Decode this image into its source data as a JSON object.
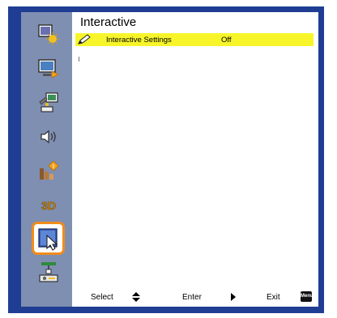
{
  "menu": {
    "title": "Interactive",
    "items": [
      {
        "label": "Interactive Settings",
        "value": "Off"
      }
    ]
  },
  "sidebar": {
    "tabs": [
      {
        "icon": "image-settings-icon"
      },
      {
        "icon": "display-settings-icon"
      },
      {
        "icon": "setup-icon"
      },
      {
        "icon": "volume-icon"
      },
      {
        "icon": "options-icon"
      },
      {
        "icon": "3d-icon",
        "label": "3D"
      },
      {
        "icon": "interactive-icon",
        "active": true
      },
      {
        "icon": "lan-icon"
      }
    ]
  },
  "footer": {
    "select_label": "Select",
    "enter_label": "Enter",
    "exit_label": "Exit",
    "menu_key_label": "Menu"
  },
  "colors": {
    "frame": "#1f3d92",
    "sidebar": "#7f8fb2",
    "highlight": "#f7f52a",
    "active_tab_outline": "#f08c1a"
  }
}
